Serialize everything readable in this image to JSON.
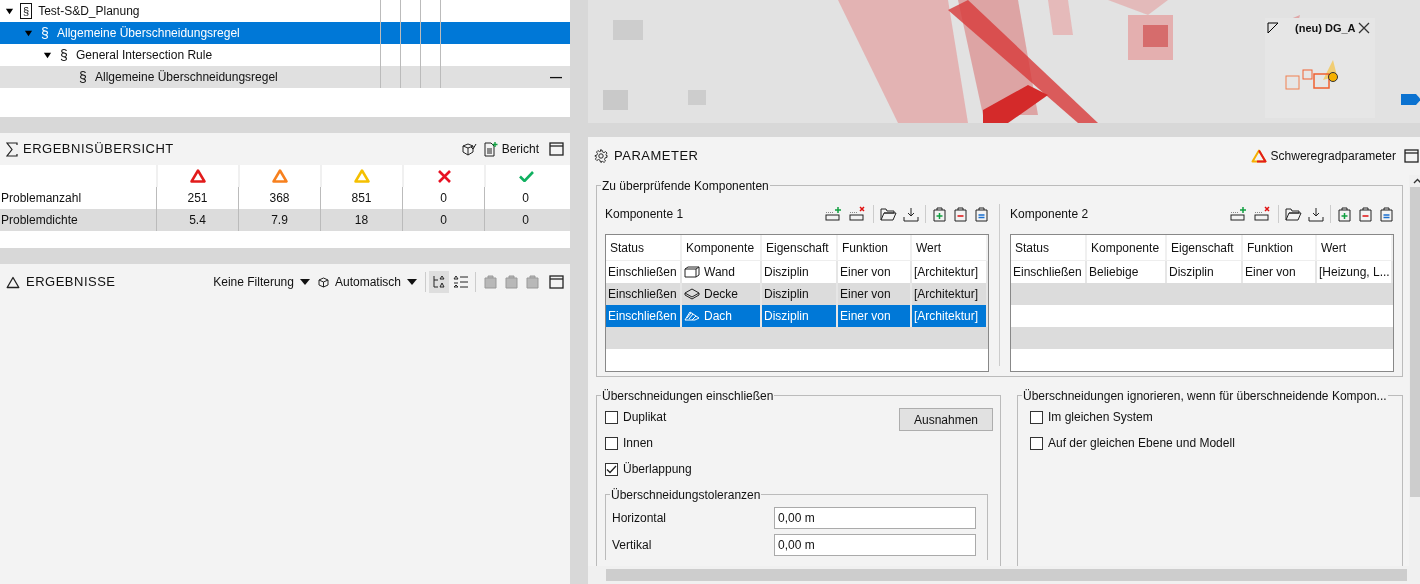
{
  "tree": [
    {
      "label": "Test-S&D_Planung",
      "symbol": "§",
      "kind": "book",
      "expanded": true,
      "selected": false,
      "children": [
        {
          "label": "Allgemeine Überschneidungsregel",
          "symbol": "§",
          "expanded": true,
          "selected": true,
          "children": [
            {
              "label": "General Intersection Rule",
              "symbol": "§",
              "expanded": true,
              "selected": false,
              "children": [
                {
                  "label": "Allgemeine Überschneidungsregel",
                  "symbol": "§",
                  "selected": false,
                  "marker": "—"
                }
              ]
            }
          ]
        }
      ]
    }
  ],
  "summary": {
    "title": "ERGEBNISÜBERSICHT",
    "report": "Bericht",
    "columns": [
      {
        "kind": "triangle",
        "color": "#e21b1b"
      },
      {
        "kind": "triangle",
        "color": "#f7801e"
      },
      {
        "kind": "triangle",
        "color": "#f5c000"
      },
      {
        "kind": "cross",
        "color": "#e81123"
      },
      {
        "kind": "check",
        "color": "#10b060"
      }
    ],
    "rows": [
      {
        "label": "Problemanzahl",
        "values": [
          "251",
          "368",
          "851",
          "0",
          "0"
        ]
      },
      {
        "label": "Problemdichte",
        "values": [
          "5.4",
          "7.9",
          "18",
          "0",
          "0"
        ]
      }
    ]
  },
  "results": {
    "title": "ERGEBNISSE",
    "filter": "Keine Filterung",
    "mode": "Automatisch"
  },
  "viewport": {
    "view_label": "(neu) DG_A"
  },
  "parameter": {
    "title": "PARAMETER",
    "severity": "Schweregradparameter",
    "components_group": "Zu überprüfende Komponenten",
    "components": [
      {
        "title": "Komponente 1",
        "columns": [
          "Status",
          "Komponente",
          "Eigenschaft",
          "Funktion",
          "Wert"
        ],
        "rows": [
          {
            "status": "Einschließen",
            "kind": "wall",
            "component": "Wand",
            "property": "Disziplin",
            "function": "Einer von",
            "value": "[Architektur]",
            "selected": false
          },
          {
            "status": "Einschließen",
            "kind": "slab",
            "component": "Decke",
            "property": "Disziplin",
            "function": "Einer von",
            "value": "[Architektur]",
            "selected": false
          },
          {
            "status": "Einschließen",
            "kind": "roof",
            "component": "Dach",
            "property": "Disziplin",
            "function": "Einer von",
            "value": "[Architektur]",
            "selected": true
          }
        ]
      },
      {
        "title": "Komponente 2",
        "columns": [
          "Status",
          "Komponente",
          "Eigenschaft",
          "Funktion",
          "Wert"
        ],
        "rows": [
          {
            "status": "Einschließen",
            "kind": "none",
            "component": "Beliebige",
            "property": "Disziplin",
            "function": "Einer von",
            "value": "[Heizung, L...",
            "selected": false
          }
        ]
      }
    ],
    "include_group": "Überschneidungen einschließen",
    "exceptions": "Ausnahmen",
    "include_options": [
      {
        "label": "Duplikat",
        "checked": false
      },
      {
        "label": "Innen",
        "checked": false
      },
      {
        "label": "Überlappung",
        "checked": true
      }
    ],
    "tolerance_group": "Überschneidungstoleranzen",
    "tolerances": [
      {
        "label": "Horizontal",
        "value": "0,00 m"
      },
      {
        "label": "Vertikal",
        "value": "0,00 m"
      }
    ],
    "ignore_group": "Überschneidungen ignorieren, wenn für überschneidende Kompon...",
    "ignore_options": [
      {
        "label": "Im gleichen System",
        "checked": false
      },
      {
        "label": "Auf der gleichen Ebene und Modell",
        "checked": false
      }
    ]
  }
}
